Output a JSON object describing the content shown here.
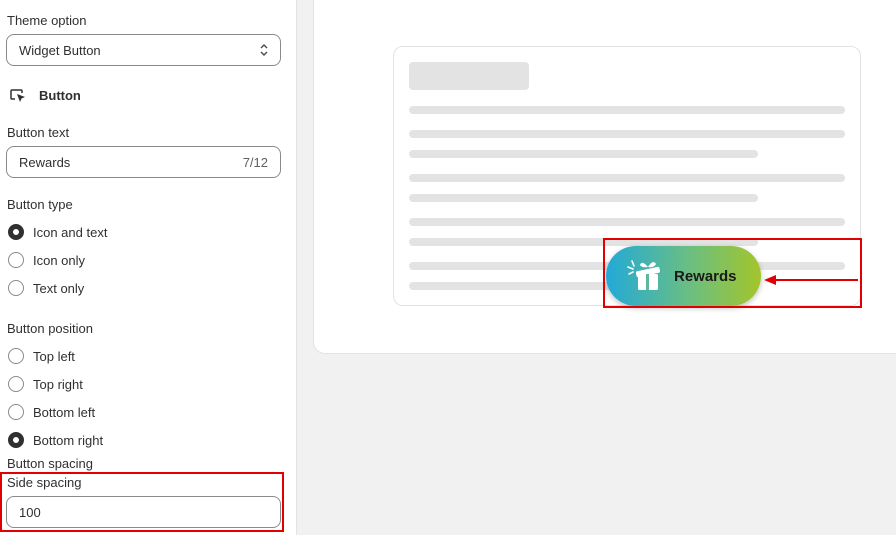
{
  "sidebar": {
    "theme_option": {
      "label": "Theme option",
      "value": "Widget Button"
    },
    "section_title": "Button",
    "button_text": {
      "label": "Button text",
      "value": "Rewards",
      "counter": "7/12"
    },
    "button_type": {
      "label": "Button type",
      "options": [
        "Icon and text",
        "Icon only",
        "Text only"
      ],
      "selected": "Icon and text"
    },
    "button_position": {
      "label": "Button position",
      "options": [
        "Top left",
        "Top right",
        "Bottom left",
        "Bottom right"
      ],
      "selected": "Bottom right"
    },
    "button_spacing": {
      "label": "Button spacing"
    },
    "side_spacing": {
      "label": "Side spacing",
      "value": "100"
    }
  },
  "preview": {
    "button_label": "Rewards",
    "button_gradient": [
      "#22a9d8",
      "#a3c52a"
    ]
  },
  "colors": {
    "highlight": "#e00000",
    "text": "#303030",
    "border": "#8a8a8a"
  }
}
